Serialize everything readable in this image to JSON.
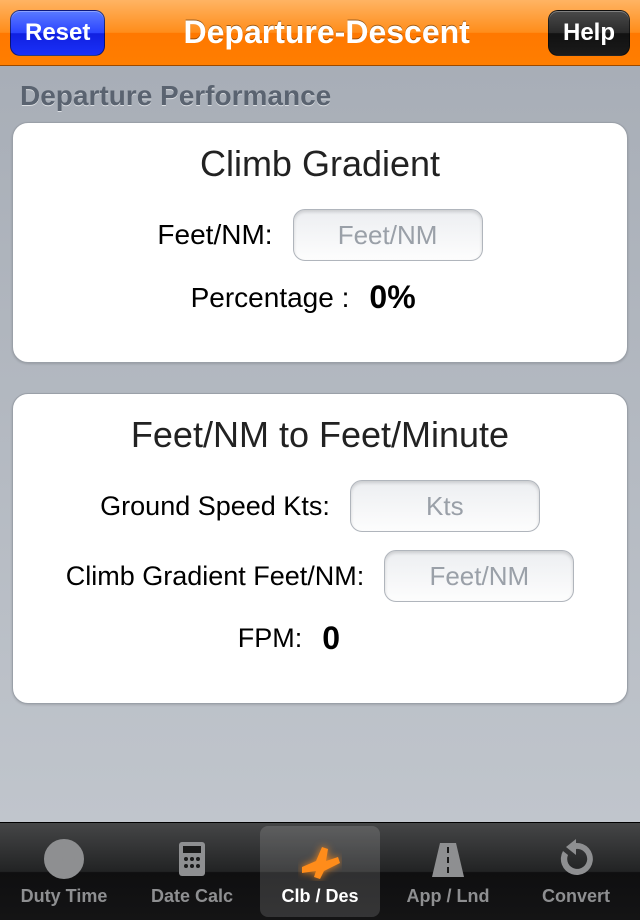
{
  "header": {
    "reset_label": "Reset",
    "title": "Departure-Descent",
    "help_label": "Help"
  },
  "section": {
    "heading": "Departure Performance"
  },
  "card1": {
    "title": "Climb Gradient",
    "feetnm_label": "Feet/NM:",
    "feetnm_placeholder": "Feet/NM",
    "percentage_label": "Percentage :",
    "percentage_value": "0%"
  },
  "card2": {
    "title": "Feet/NM to Feet/Minute",
    "gs_label": "Ground Speed Kts:",
    "gs_placeholder": "Kts",
    "cg_label": "Climb Gradient Feet/NM:",
    "cg_placeholder": "Feet/NM",
    "fpm_label": "FPM:",
    "fpm_value": "0"
  },
  "tabs": [
    {
      "label": "Duty Time"
    },
    {
      "label": "Date Calc"
    },
    {
      "label": "Clb / Des"
    },
    {
      "label": "App / Lnd"
    },
    {
      "label": "Convert"
    }
  ],
  "active_tab_index": 2
}
